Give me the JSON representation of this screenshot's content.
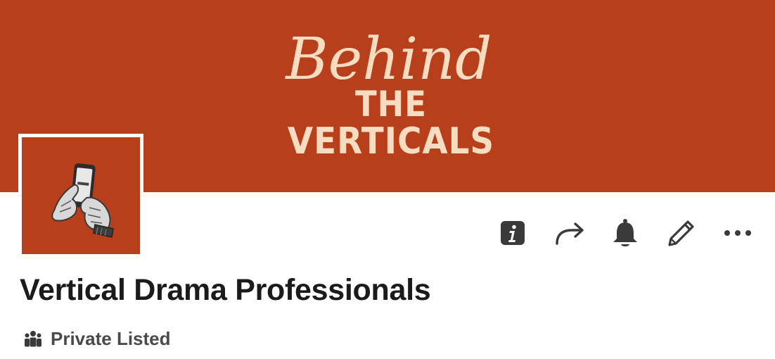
{
  "banner": {
    "script_text": "Behind",
    "line_2": "THE",
    "line_3": "VERTICALS",
    "background_color": "#b83f1b",
    "text_color": "#f6dcc0"
  },
  "avatar": {
    "icon": "hands-holding-phone-icon",
    "background_color": "#b83f1b"
  },
  "actions": [
    {
      "name": "info-button",
      "icon": "info-icon"
    },
    {
      "name": "share-button",
      "icon": "share-arrow-icon"
    },
    {
      "name": "notifications-button",
      "icon": "bell-icon"
    },
    {
      "name": "edit-button",
      "icon": "pencil-icon"
    },
    {
      "name": "more-button",
      "icon": "ellipsis-icon"
    }
  ],
  "group": {
    "name": "Vertical Drama Professionals",
    "privacy": "Private Listed",
    "privacy_icon": "people-icon"
  }
}
